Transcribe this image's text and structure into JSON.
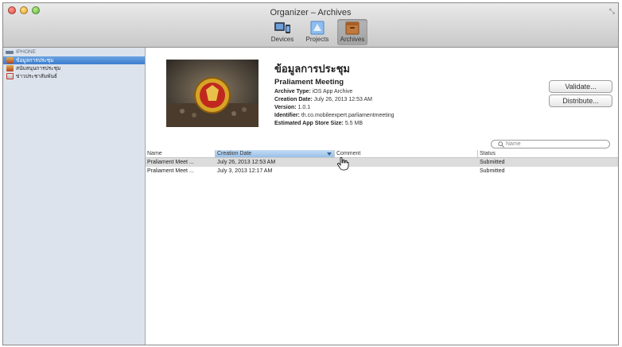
{
  "window": {
    "title": "Organizer – Archives",
    "resize_glyph": "⤡"
  },
  "toolbar": {
    "items": [
      {
        "label": "Devices",
        "icon": "devices-icon"
      },
      {
        "label": "Projects",
        "icon": "projects-icon"
      },
      {
        "label": "Archives",
        "icon": "archives-icon",
        "active": true
      }
    ]
  },
  "sidebar": {
    "header": "IPHONE",
    "items": [
      {
        "label": "ข้อมูลการประชุม",
        "selected": true
      },
      {
        "label": "สนับสนุนการประชุม"
      },
      {
        "label": "ข่าวประชาสัมพันธ์"
      }
    ]
  },
  "archive": {
    "thai_title": "ข้อมูลการประชุม",
    "app_name": "Praliament Meeting",
    "type_label": "Archive Type:",
    "type_value": "iOS App Archive",
    "date_label": "Creation Date:",
    "date_value": "July 26, 2013 12:53 AM",
    "version_label": "Version:",
    "version_value": "1.0.1",
    "identifier_label": "Identifier:",
    "identifier_value": "th.co.mobileexpert.parliamentmeeting",
    "size_label": "Estimated App Store Size:",
    "size_value": "5.5 MB"
  },
  "buttons": {
    "validate": "Validate...",
    "distribute": "Distribute..."
  },
  "search": {
    "placeholder": "Name"
  },
  "table": {
    "headers": {
      "name": "Name",
      "date": "Creation Date",
      "comment": "Comment",
      "status": "Status"
    },
    "rows": [
      {
        "name": "Praliament Meet ...",
        "date": "July 26, 2013 12:53 AM",
        "comment": "",
        "status": "Submitted"
      },
      {
        "name": "Praliament Meet ...",
        "date": "July 3, 2013 12:17 AM",
        "comment": "",
        "status": "Submitted"
      }
    ]
  }
}
